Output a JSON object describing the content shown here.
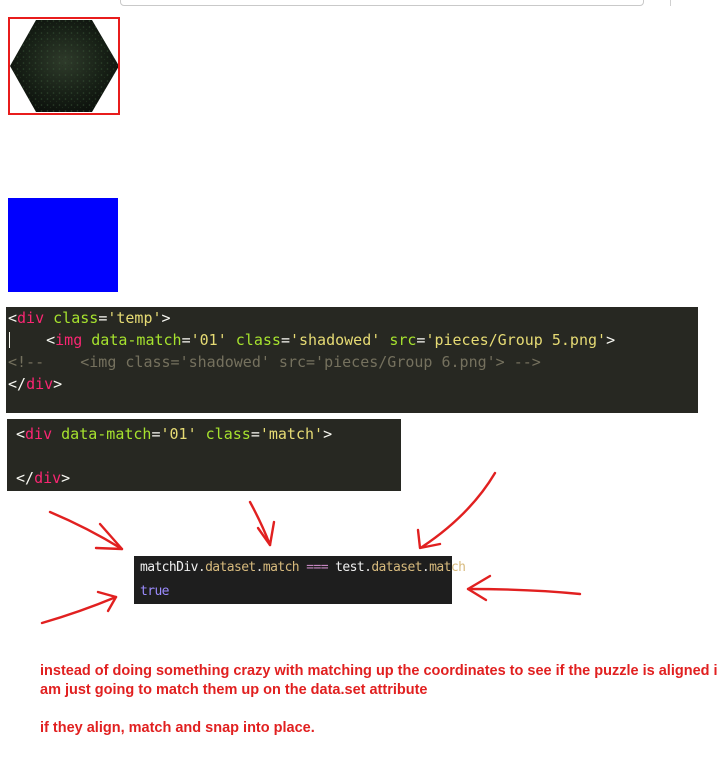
{
  "colors": {
    "frame_red": "#e81c1c",
    "blue_square": "#0000ff",
    "editor_bg": "#272822",
    "console_bg": "#1e1e1e",
    "annotation_red": "#e12020"
  },
  "images": {
    "hexagon_piece": "dark hexagon puzzle piece"
  },
  "code_block_1": {
    "l1": [
      "<",
      "div",
      " ",
      "class",
      "=",
      "'temp'",
      ">"
    ],
    "l2": [
      "    <",
      "img",
      " ",
      "data-match",
      "=",
      "'01'",
      " ",
      "class",
      "=",
      "'shadowed'",
      " ",
      "src",
      "=",
      "'pieces/Group 5.png'",
      ">"
    ],
    "l3": "<!--    <img class='shadowed' src='pieces/Group 6.png'> -->",
    "l4": [
      "</",
      "div",
      ">"
    ]
  },
  "code_block_2": {
    "l1": [
      "<",
      "div",
      " ",
      "data-match",
      "=",
      "'01'",
      " ",
      "class",
      "=",
      "'match'",
      ">"
    ],
    "l2": "",
    "l3": [
      "</",
      "div",
      ">"
    ]
  },
  "console": {
    "expression": [
      "matchDiv",
      ".",
      "dataset",
      ".",
      "match",
      " === ",
      "test",
      ".",
      "dataset",
      ".",
      "match"
    ],
    "result": "true"
  },
  "annotation": {
    "paragraph_1": "instead of doing something crazy with matching up the coordinates to see if the puzzle is aligned i am just going to match them up on the  data.set attribute",
    "paragraph_2": "if they align, match and snap into place."
  }
}
